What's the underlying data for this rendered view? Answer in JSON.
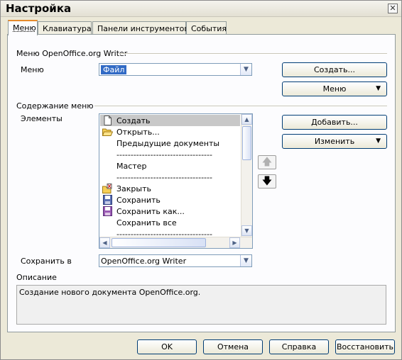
{
  "window": {
    "title": "Настройка",
    "close_glyph": "✕"
  },
  "tabs": [
    {
      "label": "Меню",
      "active": true
    },
    {
      "label": "Клавиатура",
      "active": false
    },
    {
      "label": "Панели инструментов",
      "active": false
    },
    {
      "label": "События",
      "active": false
    }
  ],
  "menu_section": {
    "header": "Меню OpenOffice.org Writer",
    "menu_label": "Меню",
    "menu_value": "Файл",
    "create_button": "Создать...",
    "menu_button": "Меню"
  },
  "content_section": {
    "header": "Содержание меню",
    "elements_label": "Элементы",
    "items": [
      {
        "text": "Создать",
        "icon": "new-document-icon",
        "selected": true
      },
      {
        "text": "Открыть...",
        "icon": "folder-open-icon",
        "selected": false
      },
      {
        "text": "Предыдущие документы",
        "icon": "",
        "selected": false
      },
      {
        "text": "----------------------------------",
        "icon": "",
        "selected": false
      },
      {
        "text": "Мастер",
        "icon": "",
        "selected": false
      },
      {
        "text": "----------------------------------",
        "icon": "",
        "selected": false
      },
      {
        "text": "Закрыть",
        "icon": "close-document-icon",
        "selected": false
      },
      {
        "text": "Сохранить",
        "icon": "save-icon",
        "selected": false
      },
      {
        "text": "Сохранить как...",
        "icon": "save-as-icon",
        "selected": false
      },
      {
        "text": "Сохранить все",
        "icon": "",
        "selected": false
      },
      {
        "text": "----------------------------------",
        "icon": "",
        "selected": false
      }
    ],
    "add_button": "Добавить...",
    "modify_button": "Изменить",
    "up_arrow": "🡅",
    "down_arrow": "🡇"
  },
  "save_in": {
    "label": "Сохранить в",
    "value": "OpenOffice.org Writer"
  },
  "description": {
    "label": "Описание",
    "text": "Создание нового документа OpenOffice.org."
  },
  "footer": {
    "ok": "OK",
    "cancel": "Отмена",
    "help": "Справка",
    "reset": "Восстановить"
  },
  "colors": {
    "tab_accent": "#e68b2c",
    "dialog_bg": "#ece9d8",
    "selection": "#c8c8c8"
  }
}
